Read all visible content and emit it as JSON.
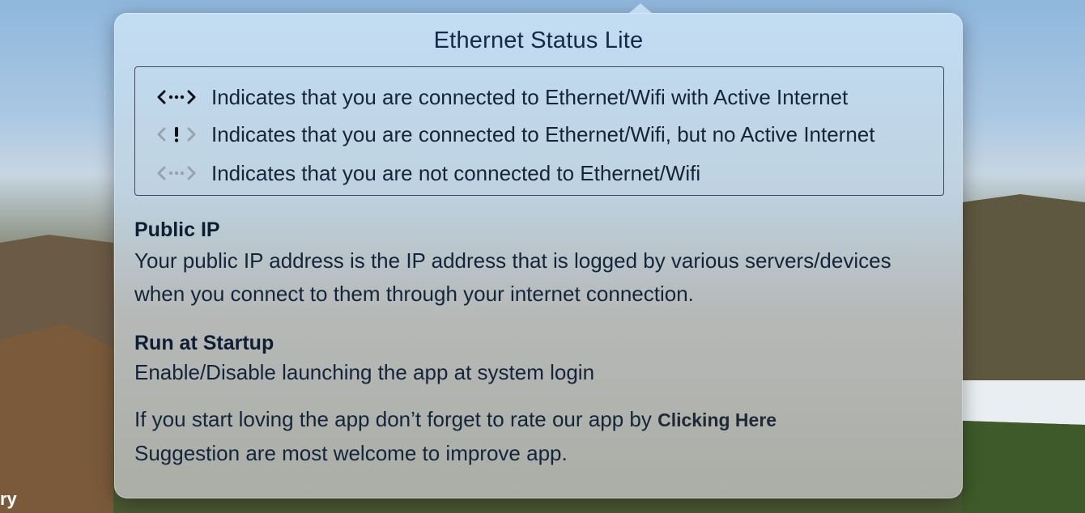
{
  "app": {
    "title": "Ethernet Status Lite"
  },
  "legend": {
    "items": [
      {
        "icon": "connected-active-icon",
        "text": "Indicates that you are connected to Ethernet/Wifi with Active Internet"
      },
      {
        "icon": "connected-no-internet-icon",
        "text": "Indicates that you are connected to Ethernet/Wifi, but no Active Internet"
      },
      {
        "icon": "disconnected-icon",
        "text": "Indicates that you are not connected to Ethernet/Wifi"
      }
    ]
  },
  "public_ip": {
    "heading": "Public IP",
    "line1": "Your public IP address is the IP address that is logged by various servers/devices",
    "line2": "when you connect to them through your internet connection."
  },
  "startup": {
    "heading": "Run at Startup",
    "text": "Enable/Disable launching the app at system login"
  },
  "rate": {
    "prefix": "If you start loving the app don’t forget to rate our app by ",
    "link": "Clicking Here",
    "suggestion": "Suggestion are most welcome to improve app."
  },
  "desktop": {
    "corner_text": "ry"
  },
  "colors": {
    "icon_active": "#111111",
    "icon_inactive": "#9aa3ab",
    "icon_alert": "#111111"
  }
}
